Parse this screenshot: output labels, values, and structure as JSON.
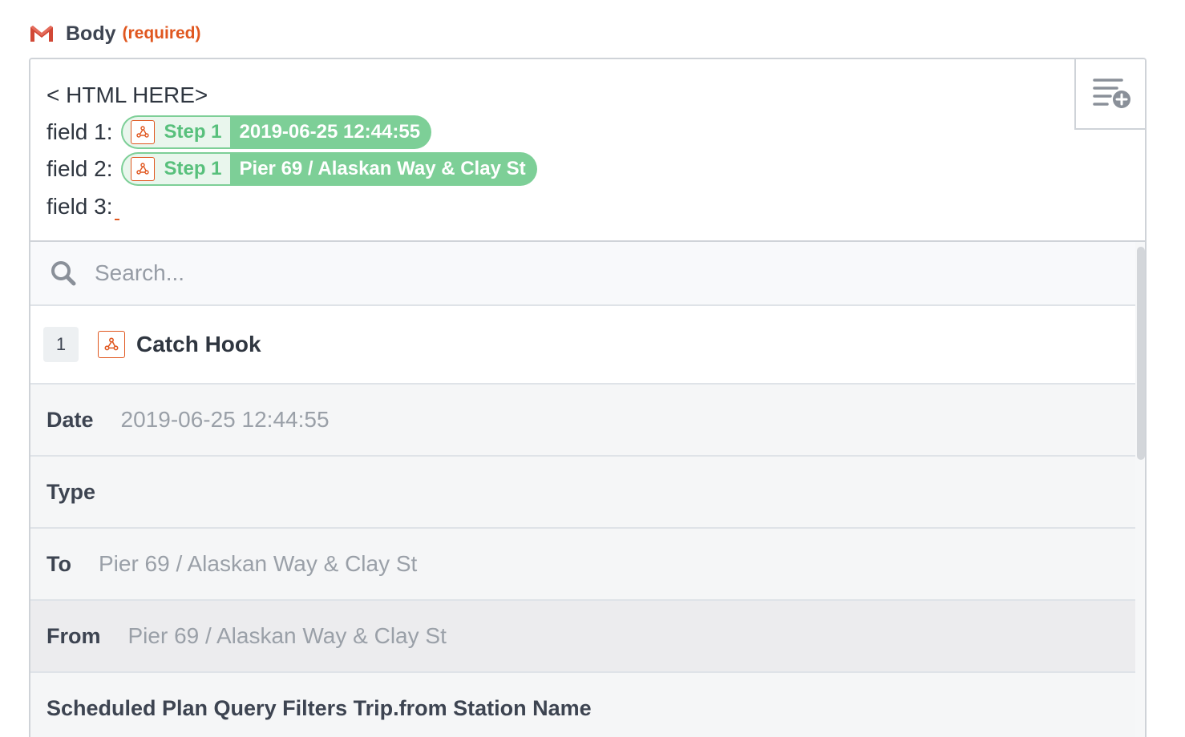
{
  "field": {
    "label": "Body",
    "required": "(required)"
  },
  "editor": {
    "lines": [
      {
        "text": "< HTML HERE>"
      },
      {
        "text": "field 1:",
        "pill": {
          "step": "Step 1",
          "value": "2019-06-25 12:44:55"
        }
      },
      {
        "text": "field 2:",
        "pill": {
          "step": "Step 1",
          "value": "Pier 69 / Alaskan Way & Clay St"
        }
      },
      {
        "text": "field 3:"
      }
    ],
    "insert_icon": "insert-field-icon"
  },
  "dropdown": {
    "search_placeholder": "Search...",
    "step": {
      "number": "1",
      "title": "Catch Hook",
      "icon": "webhook-icon"
    },
    "rows": [
      {
        "key": "Date",
        "value": "2019-06-25 12:44:55"
      },
      {
        "key": "Type",
        "value": ""
      },
      {
        "key": "To",
        "value": "Pier 69 / Alaskan Way & Clay St"
      },
      {
        "key": "From",
        "value": "Pier 69 / Alaskan Way & Clay St"
      },
      {
        "key": "Scheduled Plan Query Filters Trip.from Station Name",
        "value": ""
      }
    ]
  },
  "colors": {
    "accent": "#e0571f",
    "pill": "#7dcf97",
    "pill_step_text": "#58c07c"
  }
}
